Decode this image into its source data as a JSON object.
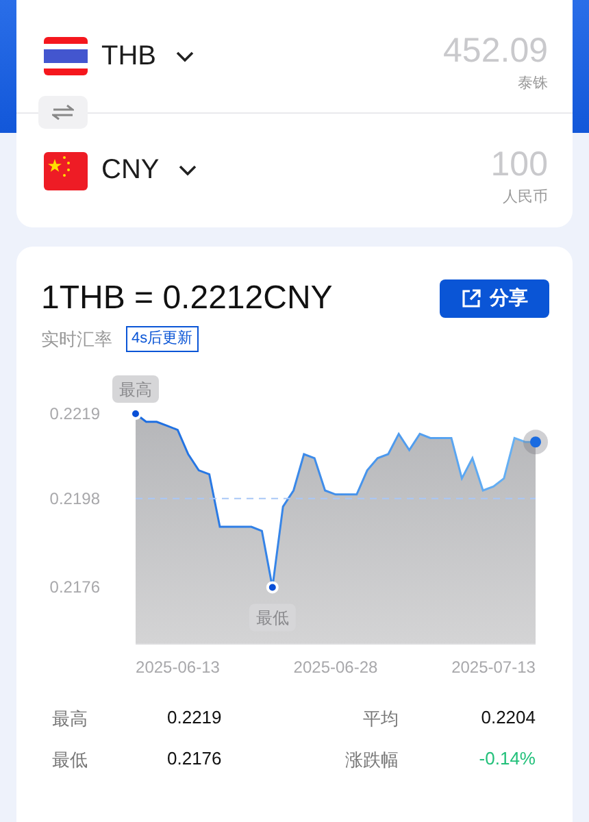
{
  "converter": {
    "rows": [
      {
        "kind": "th",
        "code": "THB",
        "amount": "452.09",
        "currency_name": "泰铢"
      },
      {
        "kind": "cn",
        "code": "CNY",
        "amount": "100",
        "currency_name": "人民币"
      }
    ]
  },
  "rate": {
    "title": "1THB = 0.2212CNY",
    "share_button": "分享",
    "subtitle": "实时汇率",
    "update_badge": "4s后更新"
  },
  "chart_data": {
    "type": "area",
    "categories": [
      null,
      null,
      null,
      null,
      "2025-06-13",
      null,
      null,
      null,
      null,
      null,
      null,
      null,
      null,
      null,
      null,
      null,
      null,
      null,
      null,
      "2025-06-28",
      null,
      null,
      null,
      null,
      null,
      null,
      null,
      null,
      null,
      null,
      null,
      null,
      null,
      null,
      "2025-07-13",
      null,
      null,
      null,
      null
    ],
    "series": [
      {
        "color": "#1a6be0",
        "values": [
          0.2219,
          0.2217,
          0.2217,
          0.2216,
          0.2215,
          0.2209,
          0.2205,
          0.2204,
          0.2191,
          0.2191,
          0.2191,
          0.2191,
          0.219,
          0.2176,
          0.2196,
          0.22,
          0.2209,
          0.2208,
          0.22,
          0.2199,
          0.2199,
          0.2199,
          0.2205,
          0.2208,
          0.2209,
          0.2214,
          0.221,
          0.2214,
          0.2213,
          0.2213,
          0.2213,
          0.2203,
          0.2208,
          0.22,
          0.2201,
          0.2203,
          0.2213,
          0.2212,
          0.2212
        ]
      },
      {
        "type": "line",
        "line_style": "dashed",
        "color": "#a9c8f7",
        "values": [
          0.2198,
          0.2198,
          0.2198,
          0.2198,
          0.2198,
          0.2198,
          0.2198,
          0.2198,
          0.2198,
          0.2198,
          0.2198,
          0.2198,
          0.2198,
          0.2198,
          0.2198,
          0.2198,
          0.2198,
          0.2198,
          0.2198,
          0.2198,
          0.2198,
          0.2198,
          0.2198,
          0.2198,
          0.2198,
          0.2198,
          0.2198,
          0.2198,
          0.2198,
          0.2198,
          0.2198,
          0.2198,
          0.2198,
          0.2198,
          0.2198,
          0.2198,
          0.2198,
          0.2198,
          0.2198
        ]
      }
    ],
    "ylim": [
      0.2162,
      0.2219
    ],
    "yticks": [
      0.2219,
      0.2198,
      0.2176
    ],
    "annotations": [
      {
        "y": 0.2219,
        "text": "最高"
      },
      {
        "y": 0.2176,
        "text": "最低"
      }
    ]
  },
  "stats": [
    {
      "label": "最高",
      "value": "0.2219",
      "color": "#111111"
    },
    {
      "label": "平均",
      "value": "0.2204",
      "color": "#111111"
    },
    {
      "label": "最低",
      "value": "0.2176",
      "color": "#111111"
    },
    {
      "label": "涨跌幅",
      "value": "-0.14%",
      "color": "#22c07a"
    }
  ]
}
